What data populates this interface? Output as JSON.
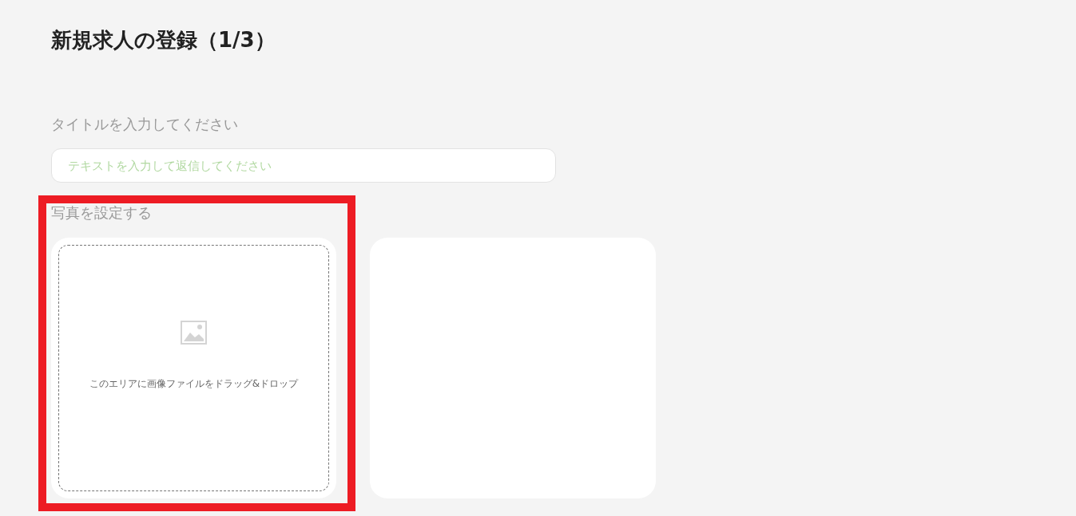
{
  "page_title": "新規求人の登録（1/3）",
  "title_field": {
    "label": "タイトルを入力してください",
    "placeholder": "テキストを入力して返信してください"
  },
  "photo_section": {
    "label": "写真を設定する",
    "highlighted": true,
    "dropzone": {
      "text": "このエリアに画像ファイルをドラッグ&ドロップ"
    }
  }
}
